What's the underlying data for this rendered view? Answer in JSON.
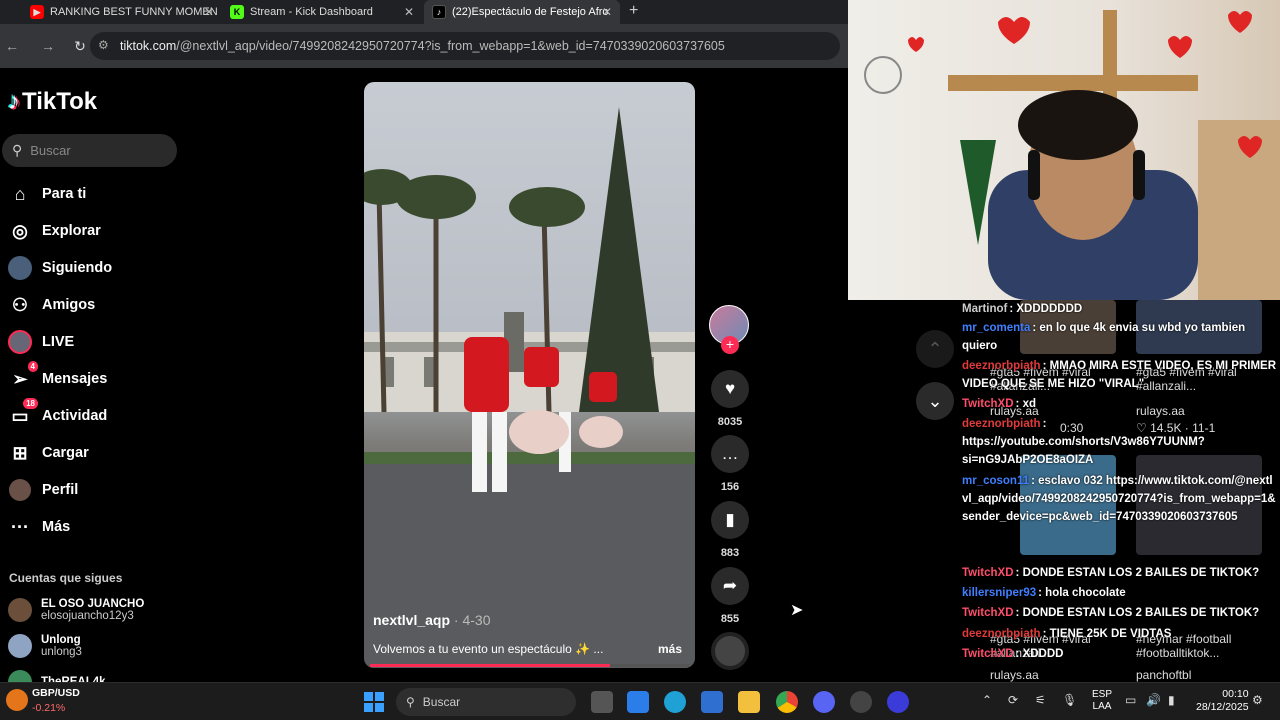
{
  "tabs": [
    {
      "title": "RANKING BEST FUNNY MOMEN",
      "icon": "youtube-icon"
    },
    {
      "title": "Stream - Kick Dashboard",
      "icon": "kick-icon"
    },
    {
      "title": "(22)Espectáculo de Festejo Afro",
      "icon": "tiktok-icon"
    }
  ],
  "address": {
    "host": "tiktok.com",
    "path": "/@nextlvl_aqp/video/7499208242950720774?is_from_webapp=1&web_id=7470339020603737605"
  },
  "tiktok": {
    "logo": "TikTok",
    "search_placeholder": "Buscar",
    "nav": [
      {
        "label": "Para ti",
        "icon": "home-icon"
      },
      {
        "label": "Explorar",
        "icon": "compass-icon"
      },
      {
        "label": "Siguiendo",
        "icon": "following-icon"
      },
      {
        "label": "Amigos",
        "icon": "friends-icon"
      },
      {
        "label": "LIVE",
        "icon": "live-icon"
      },
      {
        "label": "Mensajes",
        "icon": "messages-icon",
        "badge": "4"
      },
      {
        "label": "Actividad",
        "icon": "activity-icon",
        "badge": "18"
      },
      {
        "label": "Cargar",
        "icon": "upload-icon"
      },
      {
        "label": "Perfil",
        "icon": "profile-icon"
      },
      {
        "label": "Más",
        "icon": "more-icon"
      }
    ],
    "following_title": "Cuentas que sigues",
    "following": [
      {
        "name": "EL OSO JUANCHO",
        "handle": "elosojuancho12y3"
      },
      {
        "name": "Unlong",
        "handle": "unlong3"
      },
      {
        "name": "TheREAL4k",
        "handle": ""
      }
    ]
  },
  "video": {
    "author": "nextlvl_aqp",
    "date": "· 4-30",
    "caption": "Volvemos a tu evento un espectáculo ✨ ...",
    "more": "más",
    "progress": 0.75,
    "likes": "8035",
    "comments": "156",
    "saves": "883",
    "shares": "855"
  },
  "chat": [
    {
      "user": "Martinof",
      "msg": ": XDDDDDDD",
      "color": "#ccc"
    },
    {
      "user": "mr_comenta",
      "msg": ": en lo que 4k envia su wbd yo tambien quiero",
      "color": "#3f7fff"
    },
    {
      "user": "deeznorbpiath",
      "msg": ": MMAO MIRA ESTE VIDEO, ES MI PRIMER VIDEO QUE SE ME HIZO \"VIRAL\"",
      "color": "#e03a3a"
    },
    {
      "user": "TwitchXD",
      "msg": ": xd",
      "color": "#ff4d6a"
    },
    {
      "user": "deeznorbpiath",
      "msg": ": https://youtube.com/shorts/V3w86Y7UUNM?si=nG9JAbP2OE8aOIZA",
      "color": "#e03a3a"
    },
    {
      "user": "mr_coson11",
      "msg": ": esclavo 032 https://www.tiktok.com/@nextlvl_aqp/video/7499208242950720774?is_from_webapp=1&sender_device=pc&web_id=7470339020603737605",
      "color": "#3f7fff"
    },
    {
      "user": "TwitchXD",
      "msg": ": DONDE ESTAN LOS 2 BAILES DE TIKTOK?",
      "color": "#ff4d6a"
    },
    {
      "user": "killersniper93",
      "msg": ": hola chocolate",
      "color": "#3f7fff"
    },
    {
      "user": "TwitchXD",
      "msg": ": DONDE ESTAN LOS 2 BAILES DE TIKTOK?",
      "color": "#ff4d6a"
    },
    {
      "user": "deeznorbpiath",
      "msg": ": TIENE 25K DE VIDTAS",
      "color": "#e03a3a"
    },
    {
      "user": "TwitchXD",
      "msg": ": XDDDD",
      "color": "#ff4d6a"
    }
  ],
  "suggested": [
    {
      "tags": "#gta5 #fivem #viral #allanzali...",
      "author": "rulays.aa"
    },
    {
      "tags": "#gta5 #fivem #viral #allanzali...",
      "author": "rulays.aa"
    },
    {
      "tags": "#gta5 #fivem #viral #allanzali...",
      "author": "rulays.aa"
    },
    {
      "tags": "#neymar #football #footballtiktok...",
      "author": "panchoftbl"
    }
  ],
  "suggested_stats": {
    "views": "14.5K",
    "date": "11-1",
    "time": "0:30"
  },
  "taskbar": {
    "ticker_pair": "GBP/USD",
    "ticker_change": "-0.21%",
    "search": "Buscar",
    "lang": "ESP",
    "region": "LAA",
    "time": "00:10",
    "date": "28/12/2025"
  }
}
